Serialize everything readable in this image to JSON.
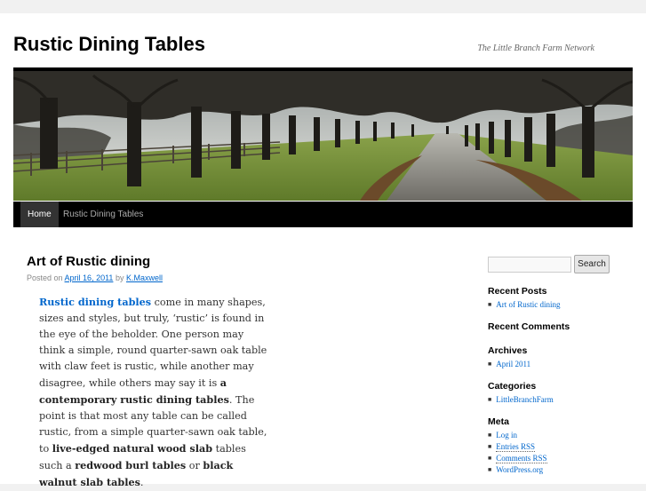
{
  "site": {
    "title": "Rustic Dining Tables",
    "description": "The Little Branch Farm Network"
  },
  "nav": {
    "items": [
      {
        "label": "Home",
        "current": true
      },
      {
        "label": "Rustic Dining Tables",
        "current": false
      }
    ]
  },
  "post": {
    "title": "Art of Rustic dining",
    "meta_prefix": "Posted on",
    "date": "April 16, 2011",
    "by": "by",
    "author": "K.Maxwell",
    "body": {
      "link1": "Rustic dining tables",
      "text1": " come in many shapes, sizes and styles, but truly, ‘rustic’ is found in the eye of the beholder. One person may think a simple, round quarter-sawn oak table with claw feet is rustic, while another may disagree, while others may say it is ",
      "bold1": "a contemporary rustic dining tables",
      "text2": ".  The point is that most any table can be called rustic, from a simple quarter-sawn oak table, to ",
      "bold2": "live-edged natural wood slab",
      "text3": " tables such a ",
      "bold3": "redwood burl tables",
      "text4": " or ",
      "bold4": "black walnut slab tables",
      "text5": "."
    }
  },
  "sidebar": {
    "search": {
      "placeholder": "",
      "button_label": "Search"
    },
    "recent_posts": {
      "title": "Recent Posts",
      "items": [
        "Art of Rustic dining"
      ]
    },
    "recent_comments": {
      "title": "Recent Comments"
    },
    "archives": {
      "title": "Archives",
      "items": [
        "April 2011"
      ]
    },
    "categories": {
      "title": "Categories",
      "items": [
        "LittleBranchFarm"
      ]
    },
    "meta": {
      "title": "Meta",
      "items": [
        "Log in",
        "Entries RSS",
        "Comments RSS",
        "WordPress.org"
      ]
    }
  },
  "colors": {
    "link": "#0066cc",
    "nav_bar": "#000000",
    "nav_current": "#333333",
    "page_bg": "#f1f1f1"
  },
  "icons": {
    "list_bullet": "square-bullet"
  }
}
